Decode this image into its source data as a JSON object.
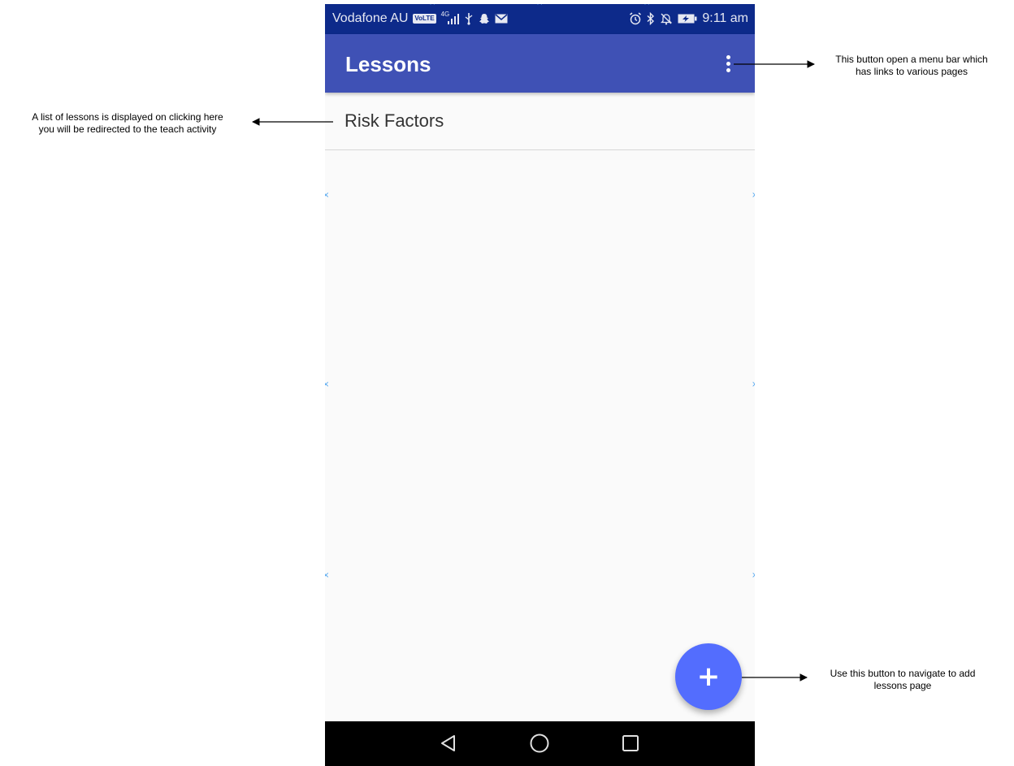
{
  "status_bar": {
    "carrier": "Vodafone AU",
    "volte_badge": "VoLTE",
    "network_type": "4G",
    "time": "9:11 am",
    "icons": [
      "volte-icon",
      "signal-icon",
      "usb-icon",
      "snapchat-icon",
      "mail-icon",
      "alarm-icon",
      "bluetooth-icon",
      "notifications-off-icon",
      "battery-charging-icon"
    ]
  },
  "app_bar": {
    "title": "Lessons",
    "overflow_icon": "more-vert-icon"
  },
  "lessons": [
    {
      "label": "Risk Factors"
    }
  ],
  "fab": {
    "icon": "plus-icon",
    "symbol": "+",
    "color": "#536dfe"
  },
  "nav_bar": {
    "icons": [
      "back-icon",
      "home-icon",
      "recents-icon"
    ]
  },
  "colors": {
    "status_bar": "#0d2a8a",
    "app_bar": "#3f51b5",
    "background": "#fafafa",
    "nav_bar": "#000000"
  },
  "annotations": {
    "menu": {
      "line1": "This button open a menu bar which",
      "line2": "has links to various pages"
    },
    "list": {
      "line1": "A list of lessons is displayed on clicking here",
      "line2": "you will be redirected to the teach activity"
    },
    "fab": {
      "line1": "Use this button to navigate to add",
      "line2": "lessons page"
    }
  }
}
